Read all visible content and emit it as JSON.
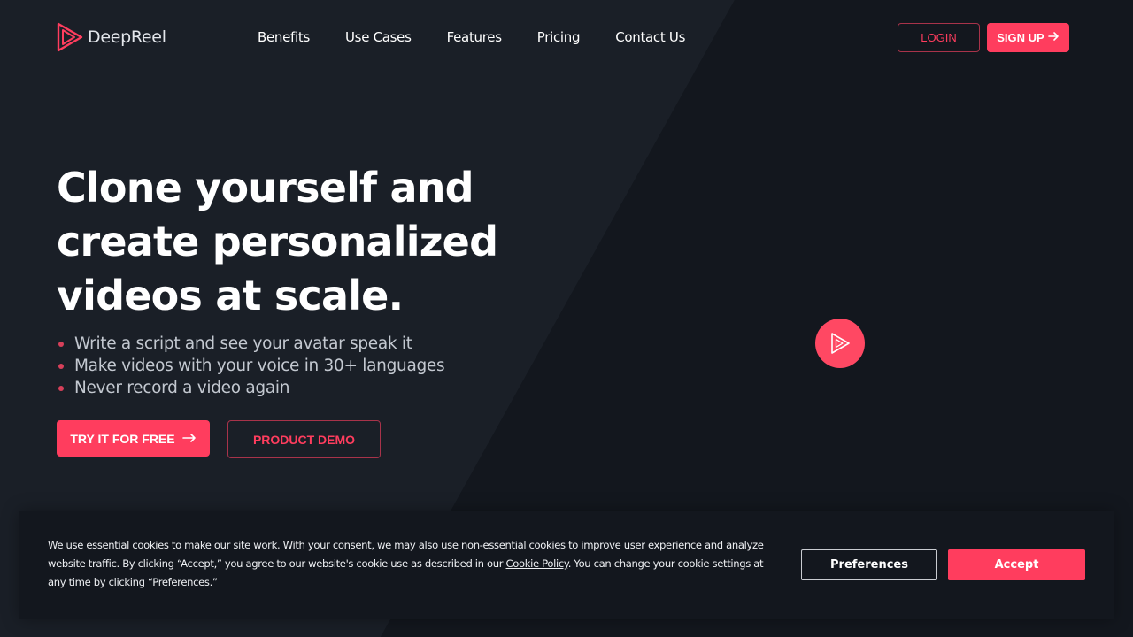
{
  "header": {
    "brand_name": "DeepReel",
    "logo_icon": "deepreel-play-logo",
    "nav": [
      {
        "label": "Benefits"
      },
      {
        "label": "Use Cases"
      },
      {
        "label": "Features"
      },
      {
        "label": "Pricing"
      },
      {
        "label": "Contact Us"
      }
    ],
    "login_label": "LOGIN",
    "signup_label": "SIGN UP",
    "signup_icon": "arrow-right"
  },
  "hero": {
    "title": "Clone yourself and create personalized videos at scale.",
    "bullets": [
      "Write a script and see your avatar speak it",
      "Make videos with your voice in 30+ languages",
      "Never record a video again"
    ],
    "try_label": "TRY IT FOR FREE",
    "try_icon": "long-arrow-right",
    "demo_label": "PRODUCT DEMO",
    "play_icon": "play-button"
  },
  "cookie_banner": {
    "text_part1": "We use essential cookies to make our site work. With your consent, we may also use non-essential cookies to improve user experience and analyze website traffic. By clicking “Accept,” you agree to our website's cookie use as described in our ",
    "cookie_policy_link": "Cookie Policy",
    "text_part2": ". You can change your cookie settings at any time by clicking “",
    "preferences_link": "Preferences",
    "text_part3": ".”",
    "preferences_label": "Preferences",
    "accept_label": "Accept"
  },
  "colors": {
    "accent": "#ff3d5e",
    "background_dark": "#13171e",
    "background_panel": "#1a1f27",
    "bullet_text": "#c3c8d0"
  }
}
